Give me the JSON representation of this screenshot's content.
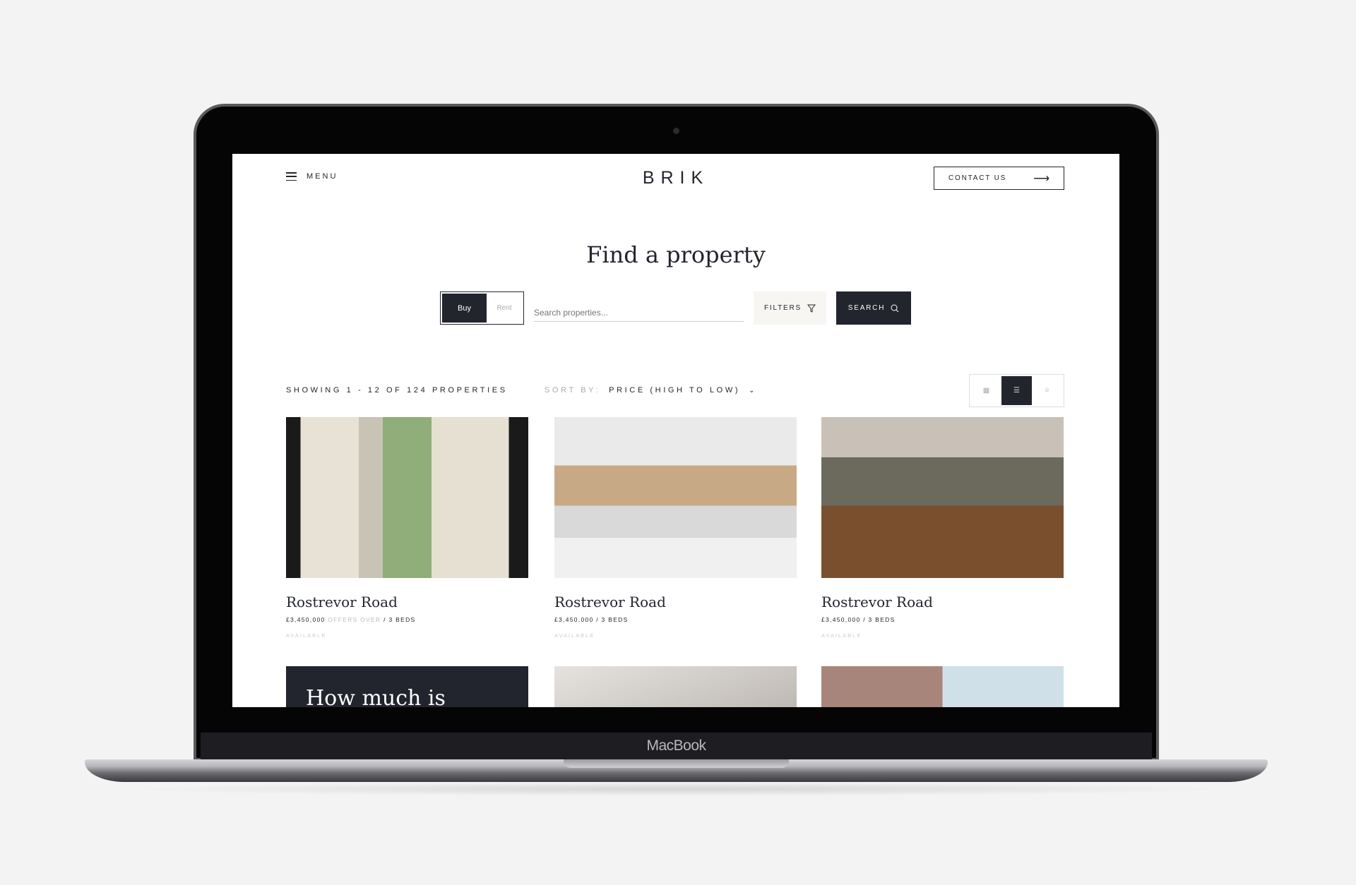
{
  "device": {
    "label": "MacBook"
  },
  "header": {
    "menu_label": "MENU",
    "logo": "BRIK",
    "contact_label": "CONTACT US"
  },
  "hero": {
    "title": "Find a property"
  },
  "search": {
    "buy_label": "Buy",
    "rent_label": "Rent",
    "placeholder": "Search properties...",
    "filters_label": "FILTERS",
    "search_label": "SEARCH"
  },
  "results": {
    "showing": "SHOWING 1 - 12 OF 124 PROPERTIES",
    "sort_label": "SORT BY:",
    "sort_value": "PRICE (HIGH TO LOW)",
    "view_active": "list"
  },
  "cards": [
    {
      "title": "Rostrevor Road",
      "price": "£3,450,000",
      "qualifier": "OFFERS OVER",
      "beds": "/ 3 BEDS",
      "status": "AVAILABLE"
    },
    {
      "title": "Rostrevor Road",
      "price": "£3,450,000",
      "qualifier": "",
      "beds": "/ 3 BEDS",
      "status": "AVAILABLE"
    },
    {
      "title": "Rostrevor Road",
      "price": "£3,450,000",
      "qualifier": "",
      "beds": "/ 3 BEDS",
      "status": "AVAILABLE"
    }
  ],
  "promo": {
    "text": "How much is"
  },
  "colors": {
    "primary": "#22252d",
    "filters_bg": "#f7f6f3"
  }
}
